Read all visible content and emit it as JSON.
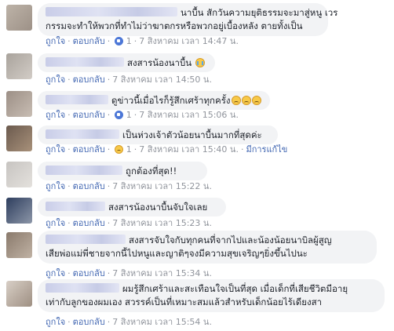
{
  "labels": {
    "like": "ถูกใจ",
    "reply": "ตอบกลับ",
    "dot": "·",
    "edited": "มีการแก้ไข"
  },
  "colors": {
    "link": "#4267b2",
    "meta": "#90949c",
    "bubble": "#f2f3f5"
  },
  "comments": [
    {
      "lines": [
        "นาบื้น สักวันความยุติธรรมจะมาสู่หนู เวร",
        "กรรมจะทำให้พวกที่ทำไม่ว่าฆาตกรหรือพวกอยู่เบื้องหลัง ตายทั้งเป็น"
      ],
      "reaction_icon": "like-icon",
      "reaction_count": "1",
      "time": "7 สิงหาคม เวลา 14:47 น."
    },
    {
      "lines": [
        "สงสารน้องนาบื้น"
      ],
      "emoji": "crying-face-icon",
      "time": "7 สิงหาคม เวลา 14:50 น."
    },
    {
      "lines": [
        "ดูข่าวนี้เมื่อไรก็รู้สึกเศร้าทุกครั้ง"
      ],
      "emoji": "sad-face-icon",
      "reaction_icon": "like-icon",
      "reaction_count": "1",
      "time": "7 สิงหาคม เวลา 15:06 น."
    },
    {
      "lines": [
        "เป็นห่วงเจ้าตัวน้อยนาบื้นมากที่สุดค่ะ"
      ],
      "reaction_icon": "sad-reaction-icon",
      "reaction_count": "1",
      "time": "7 สิงหาคม เวลา 15:40 น.",
      "edited": true
    },
    {
      "lines": [
        "ถูกต้องที่สุด!!"
      ],
      "time": "7 สิงหาคม เวลา 15:22 น."
    },
    {
      "lines": [
        "สงสารน้องนาบื้นจับใจเลย"
      ],
      "time": "7 สิงหาคม เวลา 15:23 น."
    },
    {
      "lines": [
        "สงสารจับใจกับทุกคนที่จากไปและน้องน้อยนาบิลผู้สูญ",
        "เสียพ่อแม่พี่ชายจากนี้ไปหนูและญาติๆจงมีความสุขเจริญๆยิ่งขึ้นไปนะ"
      ],
      "time": "7 สิงหาคม เวลา 15:34 น."
    },
    {
      "lines": [
        "ผมรู้สึกเศร้าและสะเทือนใจเป็นที่สุด เมื่อเด็กที่เสียชีวิตมีอายุ",
        "เท่ากับลูกของผมเอง สวรรค์เป็นที่เหมาะสมแล้วสำหรับเด็กน้อยไร้เดียงสา"
      ],
      "time": "7 สิงหาคม เวลา 15:54 น."
    }
  ]
}
